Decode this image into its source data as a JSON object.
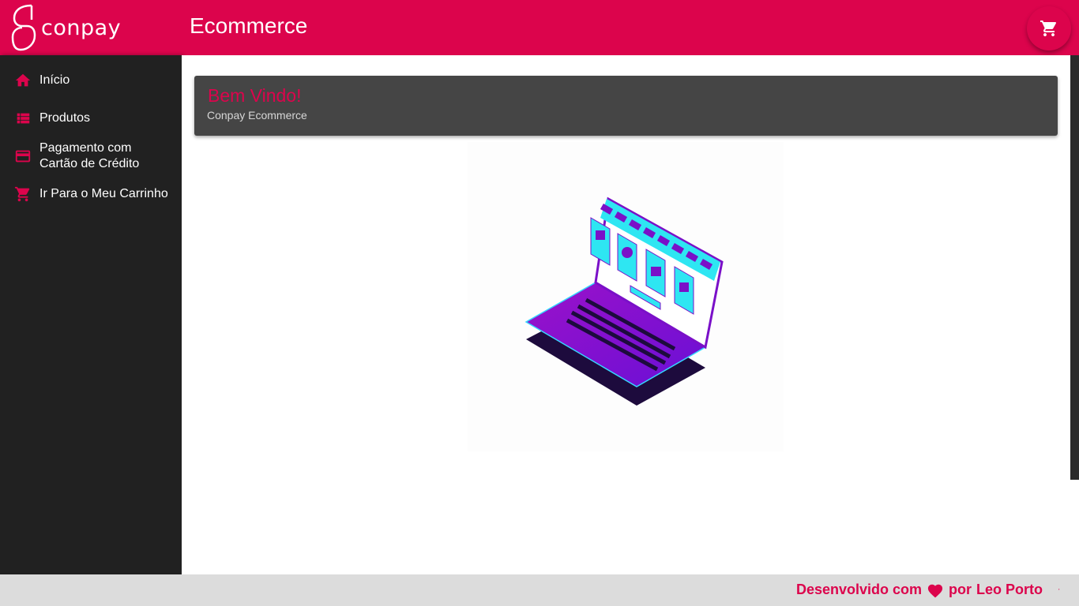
{
  "header": {
    "logo_text": "conpay",
    "title": "Ecommerce",
    "cart_icon": "cart-icon"
  },
  "sidebar": {
    "items": [
      {
        "label": "Início",
        "icon": "home-icon"
      },
      {
        "label": "Produtos",
        "icon": "list-icon"
      },
      {
        "label": "Pagamento com",
        "label2": "Cartão de Crédito",
        "icon": "credit-card-icon"
      },
      {
        "label": "Ir Para o Meu Carrinho",
        "icon": "cart-icon"
      }
    ]
  },
  "welcome": {
    "title": "Bem Vindo!",
    "subtitle": "Conpay Ecommerce"
  },
  "illustration": {
    "name": "laptop-store-illustration"
  },
  "footer": {
    "prefix": "Desenvolvido com",
    "middle": "por",
    "author": "Leo Porto"
  },
  "colors": {
    "brand": "#dc044c",
    "sidebar": "#212121",
    "card": "#454545",
    "footer": "#dcdcdc"
  }
}
